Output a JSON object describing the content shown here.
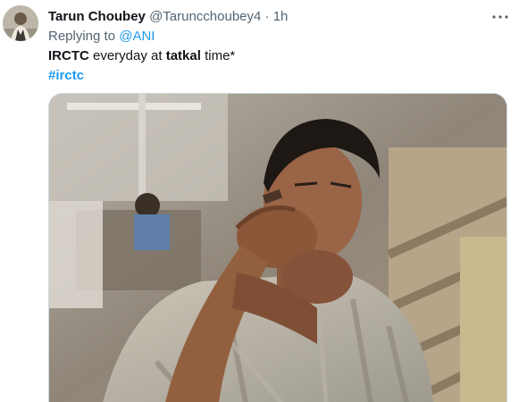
{
  "tweet": {
    "author_name": "Tarun Choubey",
    "author_handle": "@Taruncchoubey4",
    "separator": "·",
    "timestamp": "1h",
    "replying_prefix": "Replying to",
    "replying_to": "@ANI",
    "text_parts": [
      "IRCTC",
      " everyday at ",
      "tatkal",
      " time*"
    ],
    "hashtag": "#irctc",
    "more_icon": "more-horizontal-icon",
    "media_description_icon": "photo"
  },
  "colors": {
    "link": "#1d9bf0",
    "secondary_text": "#536471",
    "primary_text": "#0f1419"
  }
}
